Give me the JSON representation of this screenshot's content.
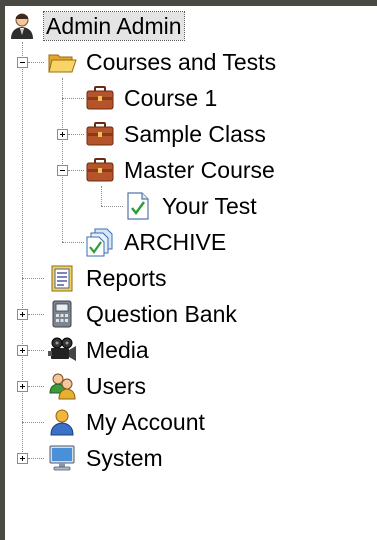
{
  "tree": {
    "root": {
      "label": "Admin Admin",
      "icon": "admin-user-icon"
    },
    "courses": {
      "label": "Courses and Tests",
      "icon": "open-folder-icon",
      "children": {
        "course1": {
          "label": "Course 1",
          "icon": "briefcase-icon"
        },
        "sample_class": {
          "label": "Sample Class",
          "icon": "briefcase-icon"
        },
        "master_course": {
          "label": "Master Course",
          "icon": "briefcase-icon",
          "children": {
            "your_test": {
              "label": "Your Test",
              "icon": "test-document-icon"
            }
          }
        },
        "archive": {
          "label": "ARCHIVE",
          "icon": "archive-icon"
        }
      }
    },
    "reports": {
      "label": "Reports",
      "icon": "reports-icon"
    },
    "question_bank": {
      "label": "Question Bank",
      "icon": "question-bank-icon"
    },
    "media": {
      "label": "Media",
      "icon": "camera-icon"
    },
    "users": {
      "label": "Users",
      "icon": "users-icon"
    },
    "my_account": {
      "label": "My Account",
      "icon": "user-icon"
    },
    "system": {
      "label": "System",
      "icon": "monitor-icon"
    }
  },
  "colors": {
    "frame": "#4a4a43",
    "tree_lines": "#8c8c8c",
    "briefcase": "#b5542a",
    "folder": "#f2c14e",
    "selection": "#e4e4e4"
  }
}
